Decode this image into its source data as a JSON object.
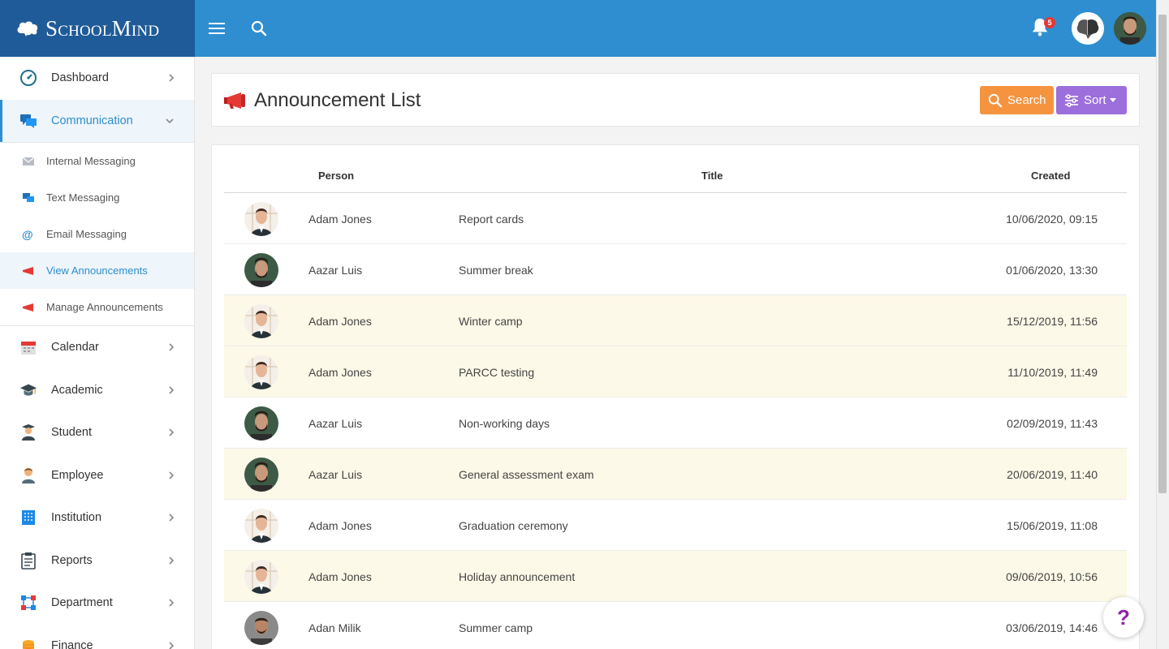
{
  "brand": {
    "name": "SchoolMind"
  },
  "topbar": {
    "notification_count": "5"
  },
  "sidebar": {
    "items_top": [
      {
        "label": "Dashboard",
        "icon": "dashboard-gauge-icon"
      },
      {
        "label": "Communication",
        "icon": "chat-bubbles-icon"
      }
    ],
    "subitems": [
      {
        "label": "Internal Messaging",
        "icon": "envelope-icon"
      },
      {
        "label": "Text Messaging",
        "icon": "chat-bubbles-icon"
      },
      {
        "label": "Email Messaging",
        "icon": "at-sign-icon"
      },
      {
        "label": "View Announcements",
        "icon": "megaphone-icon"
      },
      {
        "label": "Manage Announcements",
        "icon": "megaphone-icon"
      }
    ],
    "items_bottom": [
      {
        "label": "Calendar",
        "icon": "calendar-icon"
      },
      {
        "label": "Academic",
        "icon": "graduation-cap-icon"
      },
      {
        "label": "Student",
        "icon": "student-icon"
      },
      {
        "label": "Employee",
        "icon": "employee-icon"
      },
      {
        "label": "Institution",
        "icon": "building-icon"
      },
      {
        "label": "Reports",
        "icon": "clipboard-icon"
      },
      {
        "label": "Department",
        "icon": "org-chart-icon"
      },
      {
        "label": "Finance",
        "icon": "coins-icon"
      }
    ]
  },
  "page": {
    "title": "Announcement List",
    "search_label": "Search",
    "sort_label": "Sort"
  },
  "table": {
    "headers": {
      "person": "Person",
      "title": "Title",
      "created": "Created"
    },
    "rows": [
      {
        "person": "Adam Jones",
        "title": "Report cards",
        "created": "10/06/2020, 09:15",
        "highlight": false,
        "avatar": "adam"
      },
      {
        "person": "Aazar Luis",
        "title": "Summer break",
        "created": "01/06/2020, 13:30",
        "highlight": false,
        "avatar": "aazar"
      },
      {
        "person": "Adam Jones",
        "title": "Winter camp",
        "created": "15/12/2019, 11:56",
        "highlight": true,
        "avatar": "adam"
      },
      {
        "person": "Adam Jones",
        "title": "PARCC testing",
        "created": "11/10/2019, 11:49",
        "highlight": true,
        "avatar": "adam"
      },
      {
        "person": "Aazar Luis",
        "title": "Non-working days",
        "created": "02/09/2019, 11:43",
        "highlight": false,
        "avatar": "aazar"
      },
      {
        "person": "Aazar Luis",
        "title": "General assessment exam",
        "created": "20/06/2019, 11:40",
        "highlight": true,
        "avatar": "aazar"
      },
      {
        "person": "Adam Jones",
        "title": "Graduation ceremony",
        "created": "15/06/2019, 11:08",
        "highlight": false,
        "avatar": "adam"
      },
      {
        "person": "Adam Jones",
        "title": "Holiday announcement",
        "created": "09/06/2019, 10:56",
        "highlight": true,
        "avatar": "adam"
      },
      {
        "person": "Adan Milik",
        "title": "Summer camp",
        "created": "03/06/2019, 14:46",
        "highlight": false,
        "avatar": "adan"
      }
    ]
  },
  "help": {
    "label": "?"
  },
  "colors": {
    "topbar": "#2e8ecf",
    "brand_bg": "#1f5b98",
    "search_button": "#f5933f",
    "sort_button": "#9c6fdc",
    "row_highlight": "#fdf9e8",
    "active_text": "#2e8ecf"
  }
}
